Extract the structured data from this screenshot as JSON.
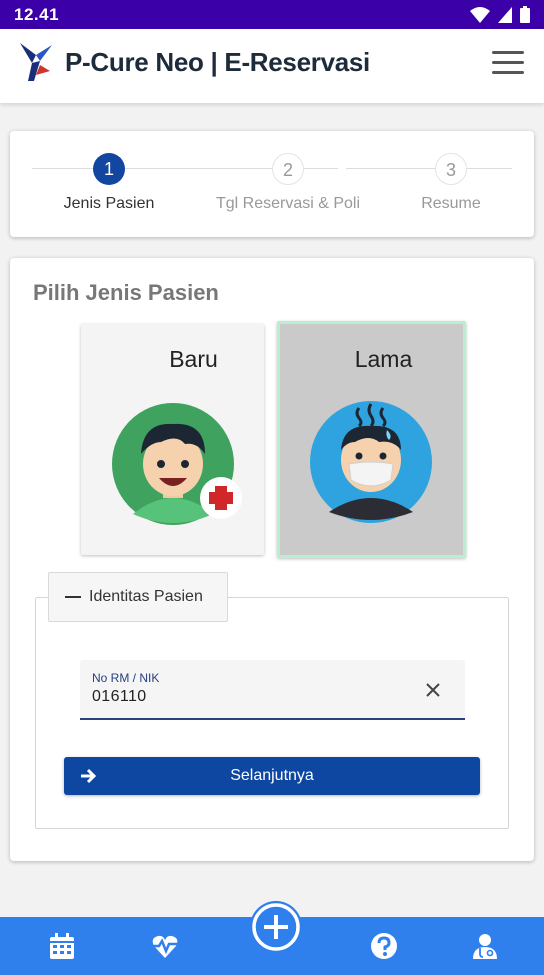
{
  "status_bar": {
    "time": "12.41",
    "icons": [
      "wifi-icon",
      "signal-icon",
      "battery-icon"
    ]
  },
  "app_bar": {
    "title": "P-Cure Neo | E-Reservasi",
    "menu_icon": "hamburger-menu-icon"
  },
  "stepper": {
    "steps": [
      {
        "number": "1",
        "label": "Jenis Pasien",
        "active": true
      },
      {
        "number": "2",
        "label": "Tgl Reservasi & Poli",
        "active": false
      },
      {
        "number": "3",
        "label": "Resume",
        "active": false
      }
    ]
  },
  "patient_type": {
    "heading": "Pilih Jenis Pasien",
    "options": [
      {
        "label": "Baru",
        "icon": "new-patient-avatar-icon",
        "selected": false
      },
      {
        "label": "Lama",
        "icon": "returning-patient-avatar-icon",
        "selected": true
      }
    ]
  },
  "identity": {
    "toggle_label": "Identitas Pasien",
    "field_label": "No RM / NIK",
    "field_value": "016110",
    "clear_icon": "close-icon",
    "next_label": "Selanjutnya",
    "next_icon": "arrow-right-icon"
  },
  "bottom_nav": {
    "items": [
      "calendar-icon",
      "heartbeat-icon",
      "add-circle-icon",
      "help-icon",
      "doctor-icon"
    ]
  },
  "colors": {
    "primary": "#0d47a1",
    "status_bar": "#3c00a8",
    "nav": "#2f80ed",
    "selected_border": "#b6f0cf"
  }
}
